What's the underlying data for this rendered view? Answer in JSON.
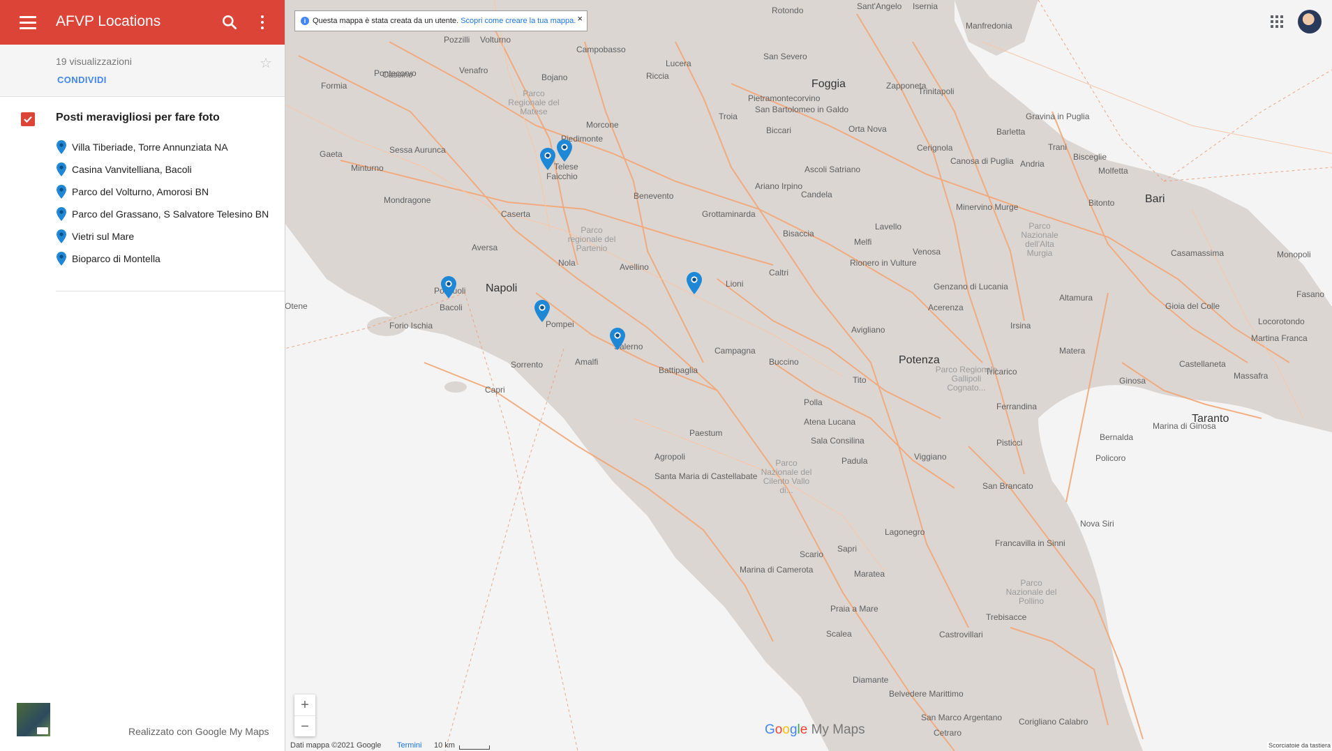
{
  "app": {
    "title": "AFVP Locations",
    "colors": {
      "header": "#db4437",
      "accent": "#4285f4",
      "pin": "#1f88d6"
    }
  },
  "map_info": {
    "views": "19 visualizzazioni",
    "share_label": "CONDIVIDI"
  },
  "layer": {
    "title": "Posti meravigliosi per fare foto",
    "checked": true,
    "places": [
      {
        "label": "Villa Tiberiade, Torre Annunziata NA"
      },
      {
        "label": "Casina Vanvitelliana, Bacoli"
      },
      {
        "label": "Parco del Volturno, Amorosi BN"
      },
      {
        "label": "Parco del Grassano, S Salvatore Telesino BN"
      },
      {
        "label": "Vietri sul Mare"
      },
      {
        "label": "Bioparco di Montella"
      }
    ]
  },
  "credit": "Realizzato con Google My Maps",
  "notice": {
    "message": "Questa mappa è stata creata da un utente.",
    "link": "Scopri come creare la tua mappa."
  },
  "footer": {
    "copyright": "Dati mappa ©2021 Google",
    "terms": "Termini",
    "scale": "10 km",
    "shortcuts": "Scorciatoie da tastiera"
  },
  "logo": {
    "brand": "Google",
    "product": "My Maps"
  },
  "labels": {
    "big": [
      "Napoli",
      "Bari",
      "Foggia",
      "Potenza",
      "Taranto"
    ],
    "cities": [
      "Manfredonia",
      "Barletta",
      "Andria",
      "Trani",
      "Bisceglie",
      "Molfetta",
      "Bitonto",
      "Altamura",
      "Gravina in Puglia",
      "Matera",
      "Monopoli",
      "Fasano",
      "Martina Franca",
      "Gioia del Colle",
      "Casamassima",
      "Locorotondo",
      "Castellaneta",
      "Massafra",
      "Ginosa",
      "Marina di Ginosa",
      "Bernalda",
      "Pisticci",
      "Ferrandina",
      "Policoro",
      "Nova Siri",
      "Trebisacce",
      "Castrovillari",
      "Corigliano Calabro",
      "San Marco Argentano",
      "Cetraro",
      "Diamante",
      "Belvedere Marittimo",
      "Scalea",
      "Praia a Mare",
      "Maratea",
      "Lagonegro",
      "Sapri",
      "Scario",
      "Marina di Camerota",
      "Padula",
      "Sala Consilina",
      "Atena Lucana",
      "Polla",
      "Viggiano",
      "Tito",
      "Avigliano",
      "Acerenza",
      "Genzano di Lucania",
      "Irsina",
      "Tricarico",
      "San Brancato",
      "Francavilla in Sinni",
      "Rionero in Vulture",
      "Venosa",
      "Melfi",
      "Lavello",
      "Minervino Murge",
      "Canosa di Puglia",
      "Cerignola",
      "Trinitapoli",
      "Zapponeta",
      "Orta Nova",
      "Ascoli Satriano",
      "Candela",
      "Bisaccia",
      "Lioni",
      "Caltri",
      "Buccino",
      "Campagna",
      "Battipaglia",
      "Paestum",
      "Agropoli",
      "Santa Maria di Castellabate",
      "Salerno",
      "Amalfi",
      "Sorrento",
      "Capri",
      "Pompei",
      "Forio Ischia",
      "Pozzuoli",
      "Bacoli",
      "Aversa",
      "Caserta",
      "Nola",
      "Avellino",
      "Benevento",
      "Grottaminarda",
      "Ariano Irpino",
      "Telese",
      "Morcone",
      "Bojano",
      "Campobasso",
      "Riccia",
      "Lucera",
      "Troia",
      "Biccari",
      "San Bartolomeo in Galdo",
      "Pietramontecorvino",
      "San Severo",
      "Rotondo",
      "Sant'Angelo",
      "Isernia",
      "Volturno",
      "Pozzilli",
      "Venafro",
      "Cassino",
      "Pontecorvo",
      "Formia",
      "Gaeta",
      "Minturno",
      "Sessa Aurunca",
      "Mondragone",
      "Piedimonte",
      "Otene",
      "Faicchio"
    ],
    "parks": [
      "Parco Regionale del Matese",
      "Parco regionale del Partenio",
      "Parco Nazionale del Cilento Vallo di...",
      "Parco Nazionale dell'Alta Murgia",
      "Parco Regionale Gallipoli Cognato...",
      "Parco Nazionale del Pollino"
    ]
  }
}
